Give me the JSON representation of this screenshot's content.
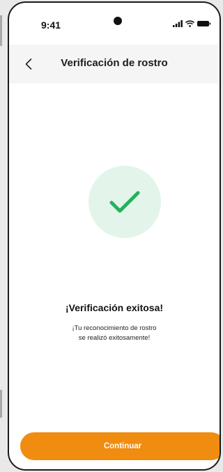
{
  "status_bar": {
    "time": "9:41",
    "icons": [
      "signal-icon",
      "wifi-icon",
      "battery-icon"
    ]
  },
  "header": {
    "back_icon": "chevron-left-icon",
    "title": "Verificación de rostro"
  },
  "main": {
    "icon": "checkmark-icon",
    "title": "¡Verificación exitosa!",
    "message_line1": "¡Tu reconocimiento de rostro",
    "message_line2": "se realizó exitosamente!"
  },
  "footer": {
    "continue_label": "Continuar"
  },
  "colors": {
    "accent": "#f08c0f",
    "success": "#22b35a",
    "success_bg": "#e3f5ea"
  }
}
